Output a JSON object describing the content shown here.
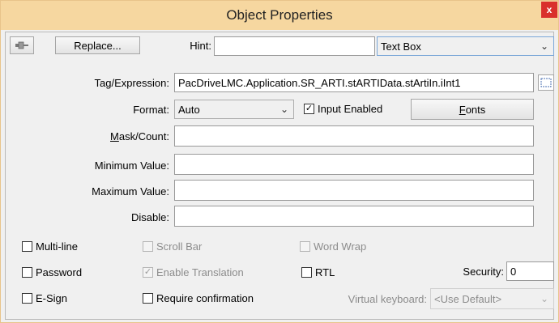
{
  "window": {
    "title": "Object Properties",
    "close_label": "x"
  },
  "toolbar": {
    "replace_label": "Replace...",
    "hint_label": "Hint:",
    "hint_value": "",
    "object_type": "Text Box"
  },
  "tag": {
    "label": "Tag/Expression:",
    "value": "PacDriveLMC.Application.SR_ARTI.stARTIData.stArtiIn.iInt1"
  },
  "format": {
    "label": "Format:",
    "value": "Auto",
    "input_enabled_label": "Input Enabled",
    "input_enabled": true,
    "fonts_label_pre": "",
    "fonts_label_ul": "F",
    "fonts_label_post": "onts"
  },
  "fields": {
    "mask_label_ul": "M",
    "mask_label_post": "ask/Count:",
    "min_label": "Minimum Value:",
    "max_label": "Maximum Value:",
    "disable_label": "Disable:"
  },
  "options": {
    "multiline": "Multi-line",
    "scrollbar": "Scroll Bar",
    "wordwrap": "Word Wrap",
    "password": "Password",
    "enable_translation": "Enable Translation",
    "rtl": "RTL",
    "security_label": "Security:",
    "security_value": "0",
    "esign": "E-Sign",
    "require_confirmation": "Require confirmation",
    "vk_label": "Virtual keyboard:",
    "vk_value": "<Use Default>"
  },
  "colors": {
    "titlebar": "#f6d7a0",
    "close": "#d9302c"
  }
}
